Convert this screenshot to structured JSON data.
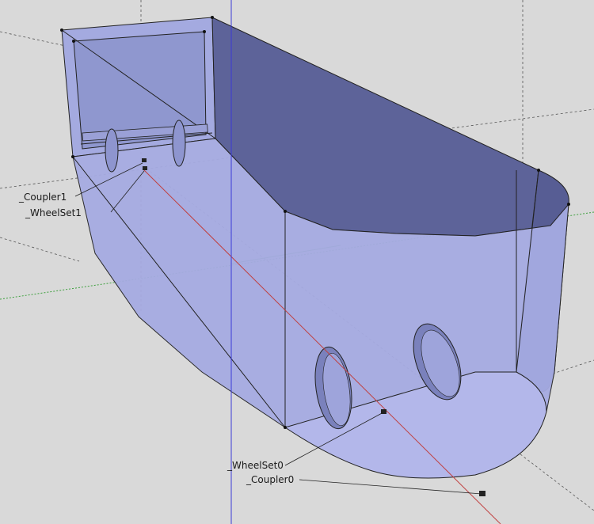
{
  "colors": {
    "background": "#d9d9d9",
    "red_axis": "#c04040",
    "green_axis": "#3fa03f",
    "blue_axis": "#3a3ad8",
    "guide": "#555555",
    "body_front": "#a9aee3",
    "body_side": "#5a6096",
    "body_top": "#7178ad",
    "edge": "#222222"
  },
  "labels": {
    "coupler1": "_Coupler1",
    "wheelset1": "_WheelSet1",
    "wheelset0": "_WheelSet0",
    "coupler0": "_Coupler0"
  }
}
